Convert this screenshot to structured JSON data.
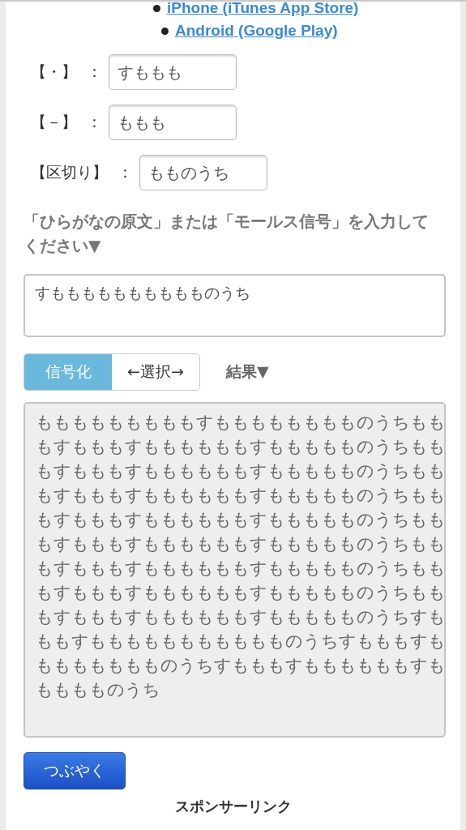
{
  "store_links": [
    {
      "label": "iPhone (iTunes App Store)"
    },
    {
      "label": "Android (Google Play)"
    }
  ],
  "settings": [
    {
      "label": "【・】",
      "separator": "：",
      "value": "すももも"
    },
    {
      "label": "【－】",
      "separator": "：",
      "value": "ももも"
    },
    {
      "label": "【区切り】",
      "separator": "：",
      "value": "もものうち"
    }
  ],
  "input_prompt": "「ひらがなの原文」または「モールス信号」を入力してください▼",
  "input_text": "すもももももももももものうち",
  "mode_tabs": [
    {
      "label": "信号化",
      "selected": true
    },
    {
      "label": "←選択→",
      "selected": false
    }
  ],
  "result_label": "結果▼",
  "result_lines": [
    "もももももももももすもももももももものうちもも",
    "もすもももすももももももすももももものうちもも",
    "もすもももすももももももすももももものうちもも",
    "もすもももすももももももすももももものうちもも",
    "もすもももすももももももすももももものうちもも",
    "もすもももすももももももすももももものうちもも",
    "もすもももすももももももすももももものうちもも",
    "もすもももすももももももすももももものうちもも",
    "もすもももすももももももすももももものうちすも",
    "ももすももももももももももものうちすもももすも",
    "ももももももものうちすもももすももももももすも",
    "もももものうち"
  ],
  "tweet_button": "つぶやく",
  "section_heading": "スポンサーリンク"
}
